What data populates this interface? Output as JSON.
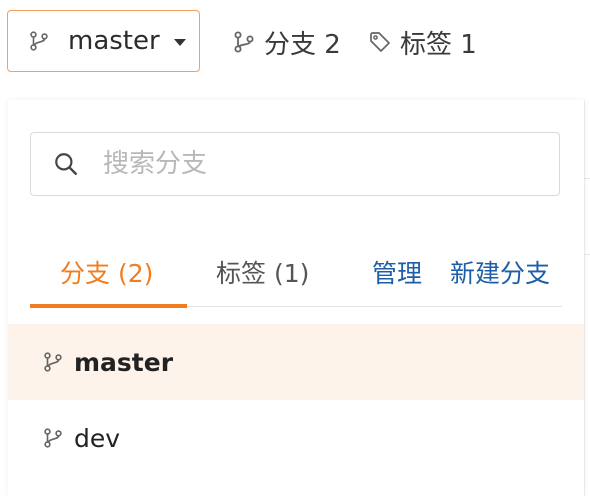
{
  "branch_selector": {
    "current": "master",
    "icon": "git-branch-icon"
  },
  "stats": {
    "branches_label": "分支 2",
    "tags_label": "标签 1"
  },
  "dropdown": {
    "search": {
      "placeholder": "搜索分支",
      "value": ""
    },
    "tabs": [
      {
        "label": "分支 (2)",
        "active": true
      },
      {
        "label": "标签 (1)",
        "active": false
      }
    ],
    "actions": {
      "manage": "管理",
      "new_branch": "新建分支"
    },
    "branches": [
      {
        "name": "master",
        "selected": true
      },
      {
        "name": "dev",
        "selected": false
      }
    ]
  },
  "colors": {
    "accent": "#f07d1f",
    "selector_border": "#f0a162",
    "link": "#1e5ea8",
    "active_row_bg": "#fdf3ea"
  }
}
